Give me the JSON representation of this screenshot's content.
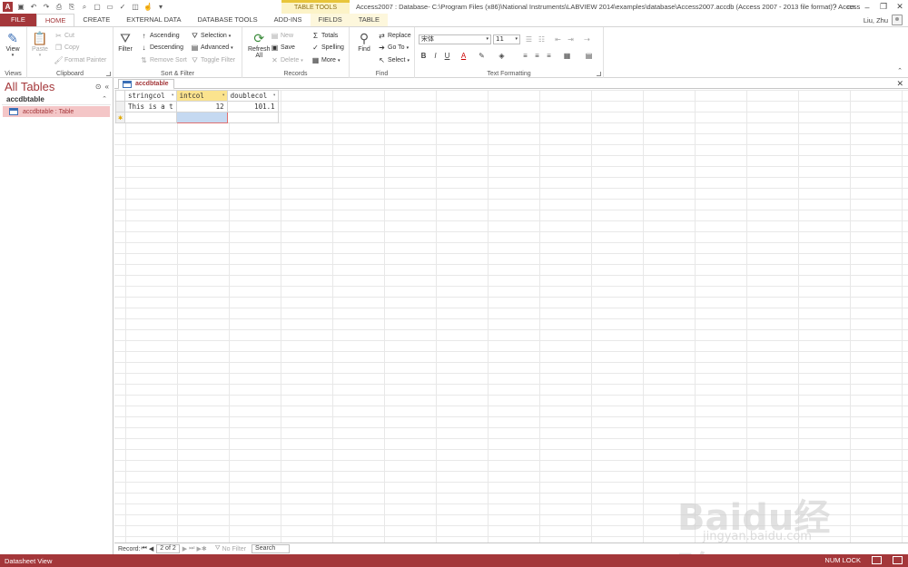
{
  "titlebar": {
    "window_title": "Access2007 : Database- C:\\Program Files (x86)\\National Instruments\\LABVIEW 2014\\examples\\database\\Access2007.accdb (Access 2007 - 2013 file format) - Access",
    "context_group": "TABLE TOOLS",
    "help": "?"
  },
  "tabs": [
    "FILE",
    "HOME",
    "CREATE",
    "EXTERNAL DATA",
    "DATABASE TOOLS",
    "ADD-INS",
    "FIELDS",
    "TABLE"
  ],
  "user": {
    "name": "Liu, Zhu"
  },
  "ribbon": {
    "views": {
      "label": "Views",
      "view_btn": "View"
    },
    "clipboard": {
      "label": "Clipboard",
      "paste": "Paste",
      "cut": "Cut",
      "copy": "Copy",
      "format_painter": "Format Painter"
    },
    "sort_filter": {
      "label": "Sort & Filter",
      "filter": "Filter",
      "ascending": "Ascending",
      "descending": "Descending",
      "remove_sort": "Remove Sort",
      "selection": "Selection",
      "advanced": "Advanced",
      "toggle_filter": "Toggle Filter"
    },
    "records": {
      "label": "Records",
      "refresh_1": "Refresh",
      "refresh_2": "All",
      "new": "New",
      "save": "Save",
      "delete": "Delete",
      "totals": "Totals",
      "spelling": "Spelling",
      "more": "More"
    },
    "find": {
      "label": "Find",
      "find": "Find",
      "replace": "Replace",
      "goto": "Go To",
      "select": "Select"
    },
    "text_formatting": {
      "label": "Text Formatting",
      "font_name": "宋体",
      "font_size": "11"
    }
  },
  "nav": {
    "title": "All Tables",
    "section": "accdbtable",
    "item": "accdbtable : Table"
  },
  "doc": {
    "tab": "accdbtable",
    "columns": [
      "stringcol",
      "intcol",
      "doublecol"
    ],
    "rows": [
      {
        "stringcol": "This is a t",
        "intcol": "12",
        "doublecol": "101.1"
      }
    ]
  },
  "recnav": {
    "record_label": "Record:",
    "position": "2 of 2",
    "filter": "No Filter",
    "search": "Search"
  },
  "status": {
    "left": "Datasheet View",
    "numlock": "NUM LOCK"
  },
  "watermark": {
    "brand": "Bai",
    "brand2": "du",
    "brand3": "经验",
    "url": "jingyan.baidu.com"
  }
}
